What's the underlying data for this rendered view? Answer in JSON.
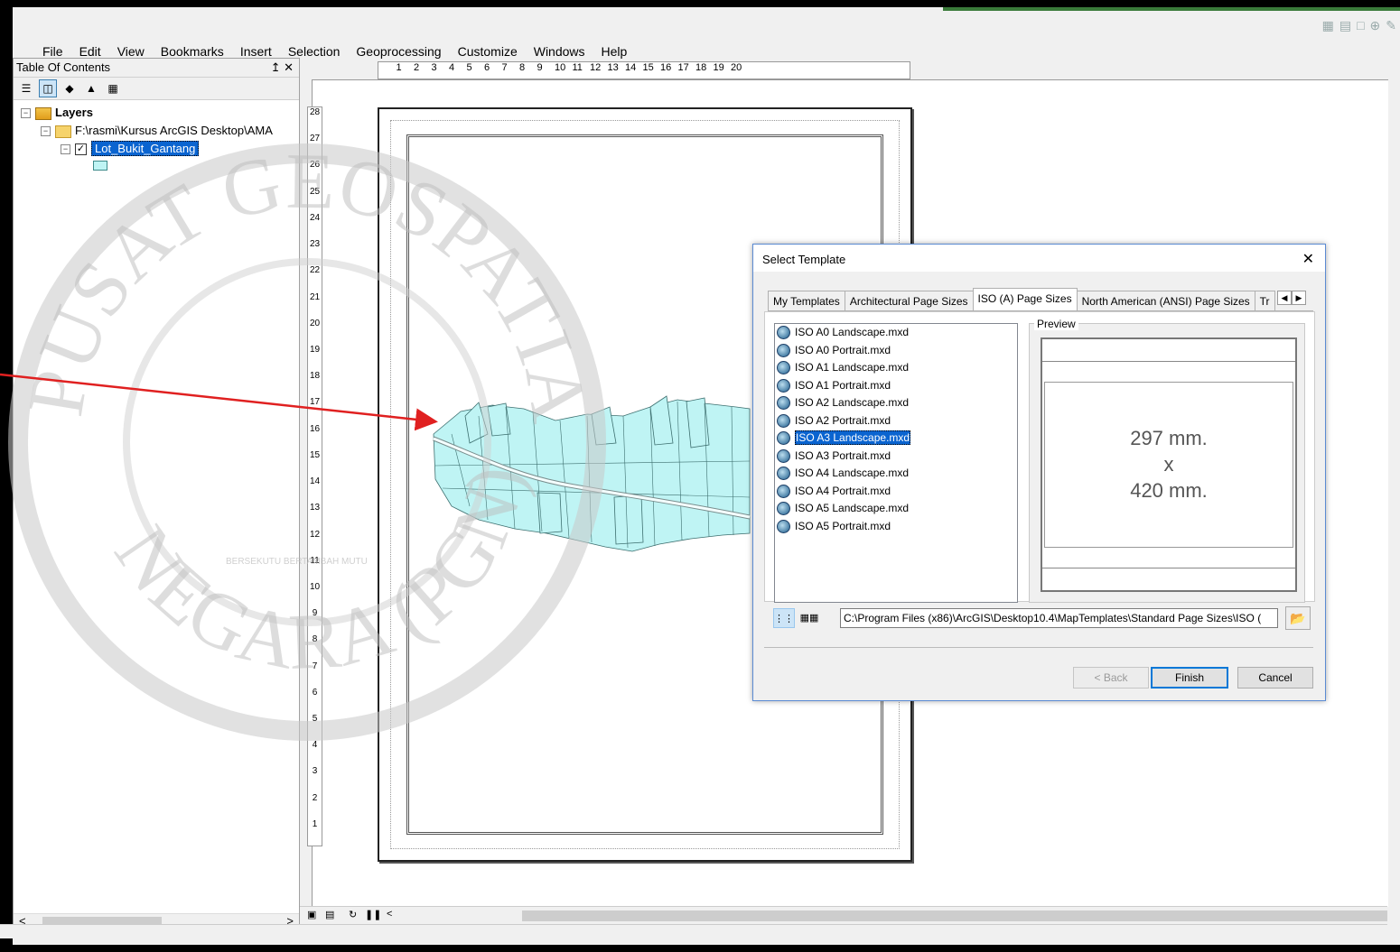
{
  "menu": [
    "File",
    "Edit",
    "View",
    "Bookmarks",
    "Insert",
    "Selection",
    "Geoprocessing",
    "Customize",
    "Windows",
    "Help"
  ],
  "toc": {
    "title": "Table Of Contents",
    "pin": "↥ ✕",
    "root_label": "Layers",
    "folder_label": "F:\\rasmi\\Kursus ArcGIS Desktop\\AMA",
    "layer_label": "Lot_Bukit_Gantang"
  },
  "hruler_ticks": [
    "",
    "1",
    "2",
    "3",
    "4",
    "5",
    "6",
    "7",
    "8",
    "9",
    "10",
    "11",
    "12",
    "13",
    "14",
    "15",
    "16",
    "17",
    "18",
    "19",
    "20"
  ],
  "vruler_ticks": [
    "28",
    "27",
    "26",
    "25",
    "24",
    "23",
    "22",
    "21",
    "20",
    "19",
    "18",
    "17",
    "16",
    "15",
    "14",
    "13",
    "12",
    "11",
    "10",
    "9",
    "8",
    "7",
    "6",
    "5",
    "4",
    "3",
    "2",
    "1"
  ],
  "watermark": {
    "top_text": "PUSAT GEOSPATIAL",
    "bottom_text": "NEGARA (PGN)",
    "motto": "BERSEKUTU BERTAMBAH MUTU"
  },
  "dialog": {
    "title": "Select Template",
    "close": "✕",
    "tabs": [
      "My Templates",
      "Architectural Page Sizes",
      "ISO (A) Page Sizes",
      "North American (ANSI) Page Sizes",
      "Tr"
    ],
    "active_tab": "ISO (A) Page Sizes",
    "files": [
      "ISO A0 Landscape.mxd",
      "ISO A0 Portrait.mxd",
      "ISO A1 Landscape.mxd",
      "ISO A1 Portrait.mxd",
      "ISO A2 Landscape.mxd",
      "ISO A2 Portrait.mxd",
      "ISO A3 Landscape.mxd",
      "ISO A3 Portrait.mxd",
      "ISO A4 Landscape.mxd",
      "ISO A4 Portrait.mxd",
      "ISO A5 Landscape.mxd",
      "ISO A5 Portrait.mxd"
    ],
    "selected_file": "ISO A3 Landscape.mxd",
    "preview_label": "Preview",
    "preview_line1": "297 mm.",
    "preview_line2": "x",
    "preview_line3": "420 mm.",
    "path": "C:\\Program Files (x86)\\ArcGIS\\Desktop10.4\\MapTemplates\\Standard Page Sizes\\ISO (",
    "buttons": {
      "back": "< Back",
      "finish": "Finish",
      "cancel": "Cancel"
    }
  },
  "colors": {
    "selection": "#0a64d0",
    "parcel_fill": "#bff4f4",
    "parcel_stroke": "#3d6f6f",
    "arrow": "#e02020",
    "dialog_border": "#5b8bd3"
  }
}
